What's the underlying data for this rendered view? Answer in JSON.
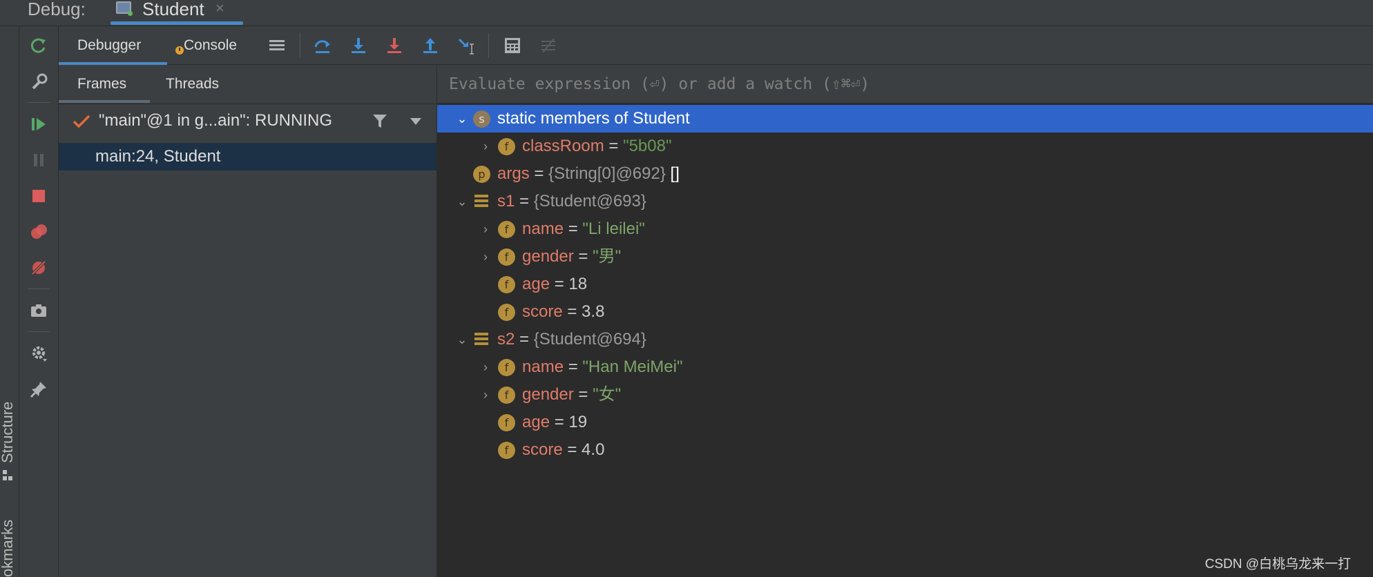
{
  "topbar": {
    "debug_label": "Debug:",
    "run_tab_label": "Student",
    "run_tab_close": "×"
  },
  "side_strip": {
    "structure_label": "Structure",
    "bookmarks_label": "okmarks"
  },
  "toolbar": {
    "debugger_tab": "Debugger",
    "console_tab": "Console"
  },
  "frames_panel": {
    "frames_tab": "Frames",
    "threads_tab": "Threads",
    "thread_label": "\"main\"@1 in g...ain\": RUNNING",
    "frame_label": "main:24, Student"
  },
  "vars_panel": {
    "eval_placeholder": "Evaluate expression (⏎) or add a watch (⇧⌘⏎)",
    "static_header": "static members of Student",
    "classroom": {
      "name": "classRoom",
      "eq": " = ",
      "value": "\"5b08\""
    },
    "args": {
      "name": "args",
      "eq": " = ",
      "ref": "{String[0]@692}",
      "extra": " []"
    },
    "s1": {
      "name": "s1",
      "eq": " = ",
      "ref": "{Student@693}"
    },
    "s1_fields": [
      {
        "name": "name",
        "eq": " = ",
        "value": "\"Li leilei\""
      },
      {
        "name": "gender",
        "eq": " = ",
        "value": "\"男\""
      },
      {
        "name": "age",
        "eq": " = ",
        "value": "18"
      },
      {
        "name": "score",
        "eq": " = ",
        "value": "3.8"
      }
    ],
    "s2": {
      "name": "s2",
      "eq": " = ",
      "ref": "{Student@694}"
    },
    "s2_fields": [
      {
        "name": "name",
        "eq": " = ",
        "value": "\"Han MeiMei\""
      },
      {
        "name": "gender",
        "eq": " = ",
        "value": "\"女\""
      },
      {
        "name": "age",
        "eq": " = ",
        "value": "19"
      },
      {
        "name": "score",
        "eq": " = ",
        "value": "4.0"
      }
    ]
  },
  "badges": {
    "field": "f",
    "param": "p",
    "static": "s"
  },
  "watermark": "CSDN @白桃乌龙来一打",
  "colors": {
    "selection": "#2f65ca",
    "field_name": "#e07c6a",
    "string_value": "#6a9955",
    "accent_tab": "#4a88c7"
  }
}
